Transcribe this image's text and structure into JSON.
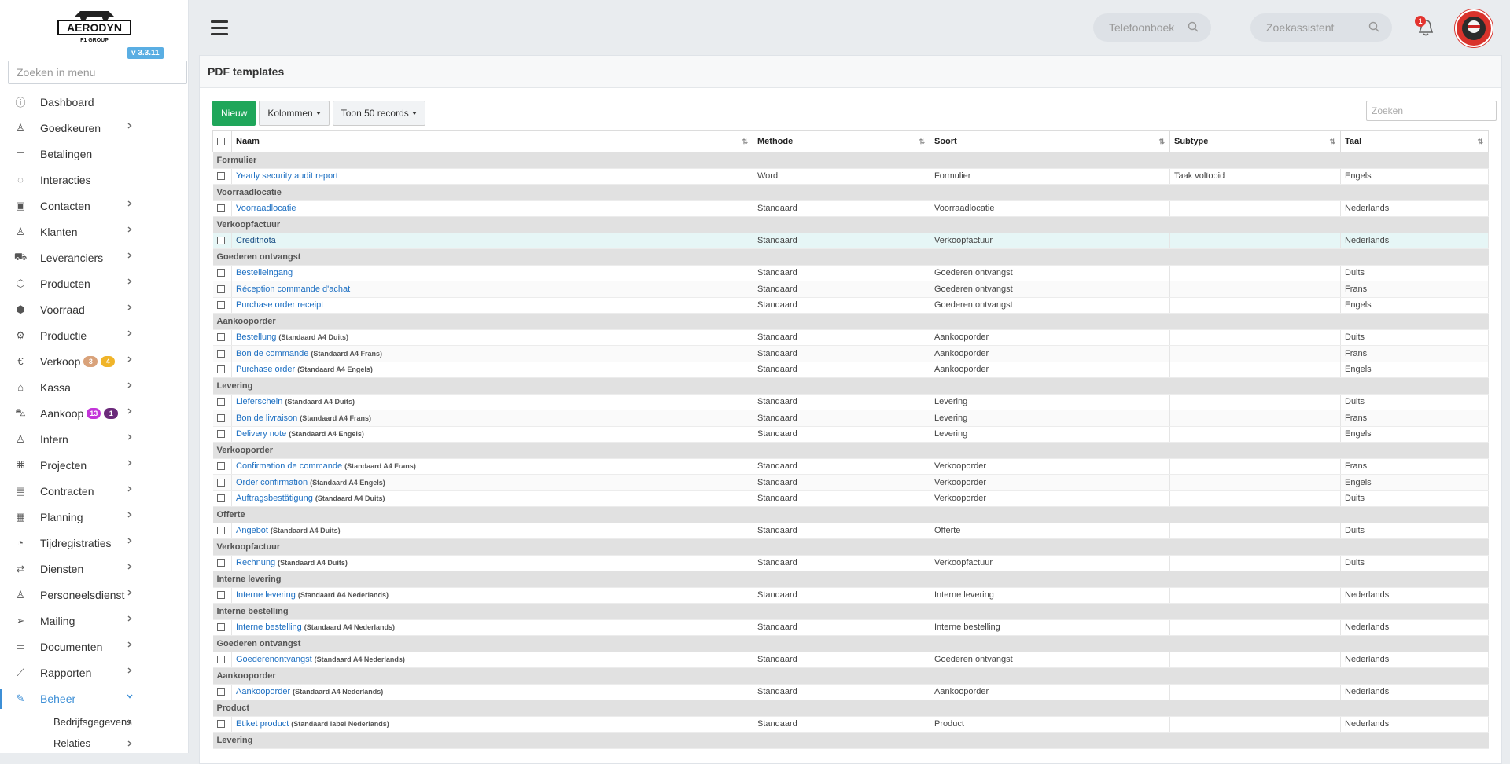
{
  "sidebar": {
    "logo_text": "AERODYN",
    "logo_sub": "F1 GROUP",
    "version": "v 3.3.11",
    "search_placeholder": "Zoeken in menu",
    "items": [
      {
        "label": "Dashboard",
        "icon": "info-icon",
        "chevron": false
      },
      {
        "label": "Goedkeuren",
        "icon": "user-check-icon",
        "chevron": true
      },
      {
        "label": "Betalingen",
        "icon": "credit-card-icon",
        "chevron": false
      },
      {
        "label": "Interacties",
        "icon": "chat-icon",
        "chevron": false
      },
      {
        "label": "Contacten",
        "icon": "contact-card-icon",
        "chevron": true
      },
      {
        "label": "Klanten",
        "icon": "customer-icon",
        "chevron": true
      },
      {
        "label": "Leveranciers",
        "icon": "truck-icon",
        "chevron": true
      },
      {
        "label": "Producten",
        "icon": "box-icon",
        "chevron": true
      },
      {
        "label": "Voorraad",
        "icon": "boxes-icon",
        "chevron": true
      },
      {
        "label": "Productie",
        "icon": "gears-icon",
        "chevron": true
      },
      {
        "label": "Verkoop",
        "icon": "euro-icon",
        "chevron": true,
        "badges": [
          {
            "text": "3",
            "color": "#d9a27a"
          },
          {
            "text": "4",
            "color": "#f0b429"
          }
        ]
      },
      {
        "label": "Kassa",
        "icon": "basket-icon",
        "chevron": true
      },
      {
        "label": "Aankoop",
        "icon": "cart-icon",
        "chevron": true,
        "badges": [
          {
            "text": "13",
            "color": "#c334d9"
          },
          {
            "text": "1",
            "color": "#6b2a7a"
          }
        ]
      },
      {
        "label": "Intern",
        "icon": "users-icon",
        "chevron": true
      },
      {
        "label": "Projecten",
        "icon": "project-icon",
        "chevron": true
      },
      {
        "label": "Contracten",
        "icon": "contract-icon",
        "chevron": true
      },
      {
        "label": "Planning",
        "icon": "calendar-icon",
        "chevron": true
      },
      {
        "label": "Tijdregistraties",
        "icon": "timer-icon",
        "chevron": true
      },
      {
        "label": "Diensten",
        "icon": "refresh-icon",
        "chevron": true
      },
      {
        "label": "Personeelsdienst",
        "icon": "person-icon",
        "chevron": true
      },
      {
        "label": "Mailing",
        "icon": "send-icon",
        "chevron": true
      },
      {
        "label": "Documenten",
        "icon": "folder-icon",
        "chevron": true
      },
      {
        "label": "Rapporten",
        "icon": "chart-line-icon",
        "chevron": true
      },
      {
        "label": "Beheer",
        "icon": "wrench-icon",
        "chevron": true,
        "active": true
      }
    ],
    "sub_items": [
      {
        "label": "Bedrijfsgegevens"
      },
      {
        "label": "Relaties"
      }
    ]
  },
  "topbar": {
    "phonebook_placeholder": "Telefoonboek",
    "assistant_placeholder": "Zoekassistent",
    "notif_count": "1"
  },
  "page": {
    "title": "PDF templates",
    "new_button": "Nieuw",
    "columns_button": "Kolommen",
    "show_button": "Toon 50 records",
    "search_placeholder": "Zoeken"
  },
  "table": {
    "headers": [
      "Naam",
      "Methode",
      "Soort",
      "Subtype",
      "Taal"
    ],
    "rows": [
      {
        "group": "Formulier"
      },
      {
        "name": "Yearly security audit report",
        "tmpl": "",
        "methode": "Word",
        "soort": "Formulier",
        "subtype": "Taak voltooid",
        "taal": "Engels"
      },
      {
        "group": "Voorraadlocatie"
      },
      {
        "name": "Voorraadlocatie",
        "tmpl": "",
        "methode": "Standaard",
        "soort": "Voorraadlocatie",
        "subtype": "",
        "taal": "Nederlands"
      },
      {
        "group": "Verkoopfactuur"
      },
      {
        "name": "Creditnota",
        "tmpl": "",
        "methode": "Standaard",
        "soort": "Verkoopfactuur",
        "subtype": "",
        "taal": "Nederlands",
        "highlight": true
      },
      {
        "group": "Goederen ontvangst"
      },
      {
        "name": "Bestelleingang",
        "tmpl": "",
        "methode": "Standaard",
        "soort": "Goederen ontvangst",
        "subtype": "",
        "taal": "Duits"
      },
      {
        "name": "Réception commande d'achat",
        "tmpl": "",
        "methode": "Standaard",
        "soort": "Goederen ontvangst",
        "subtype": "",
        "taal": "Frans"
      },
      {
        "name": "Purchase order receipt",
        "tmpl": "",
        "methode": "Standaard",
        "soort": "Goederen ontvangst",
        "subtype": "",
        "taal": "Engels"
      },
      {
        "group": "Aankooporder"
      },
      {
        "name": "Bestellung",
        "tmpl": "(Standaard A4 Duits)",
        "methode": "Standaard",
        "soort": "Aankooporder",
        "subtype": "",
        "taal": "Duits"
      },
      {
        "name": "Bon de commande",
        "tmpl": "(Standaard A4 Frans)",
        "methode": "Standaard",
        "soort": "Aankooporder",
        "subtype": "",
        "taal": "Frans"
      },
      {
        "name": "Purchase order",
        "tmpl": "(Standaard A4 Engels)",
        "methode": "Standaard",
        "soort": "Aankooporder",
        "subtype": "",
        "taal": "Engels"
      },
      {
        "group": "Levering"
      },
      {
        "name": "Lieferschein",
        "tmpl": "(Standaard A4 Duits)",
        "methode": "Standaard",
        "soort": "Levering",
        "subtype": "",
        "taal": "Duits"
      },
      {
        "name": "Bon de livraison",
        "tmpl": "(Standaard A4 Frans)",
        "methode": "Standaard",
        "soort": "Levering",
        "subtype": "",
        "taal": "Frans"
      },
      {
        "name": "Delivery note",
        "tmpl": "(Standaard A4 Engels)",
        "methode": "Standaard",
        "soort": "Levering",
        "subtype": "",
        "taal": "Engels"
      },
      {
        "group": "Verkooporder"
      },
      {
        "name": "Confirmation de commande",
        "tmpl": "(Standaard A4 Frans)",
        "methode": "Standaard",
        "soort": "Verkooporder",
        "subtype": "",
        "taal": "Frans"
      },
      {
        "name": "Order confirmation",
        "tmpl": "(Standaard A4 Engels)",
        "methode": "Standaard",
        "soort": "Verkooporder",
        "subtype": "",
        "taal": "Engels"
      },
      {
        "name": "Auftragsbestätigung",
        "tmpl": "(Standaard A4 Duits)",
        "methode": "Standaard",
        "soort": "Verkooporder",
        "subtype": "",
        "taal": "Duits"
      },
      {
        "group": "Offerte"
      },
      {
        "name": "Angebot",
        "tmpl": "(Standaard A4 Duits)",
        "methode": "Standaard",
        "soort": "Offerte",
        "subtype": "",
        "taal": "Duits"
      },
      {
        "group": "Verkoopfactuur"
      },
      {
        "name": "Rechnung",
        "tmpl": "(Standaard A4 Duits)",
        "methode": "Standaard",
        "soort": "Verkoopfactuur",
        "subtype": "",
        "taal": "Duits"
      },
      {
        "group": "Interne levering"
      },
      {
        "name": "Interne levering",
        "tmpl": "(Standaard A4 Nederlands)",
        "methode": "Standaard",
        "soort": "Interne levering",
        "subtype": "",
        "taal": "Nederlands"
      },
      {
        "group": "Interne bestelling"
      },
      {
        "name": "Interne bestelling",
        "tmpl": "(Standaard A4 Nederlands)",
        "methode": "Standaard",
        "soort": "Interne bestelling",
        "subtype": "",
        "taal": "Nederlands"
      },
      {
        "group": "Goederen ontvangst"
      },
      {
        "name": "Goederenontvangst",
        "tmpl": "(Standaard A4 Nederlands)",
        "methode": "Standaard",
        "soort": "Goederen ontvangst",
        "subtype": "",
        "taal": "Nederlands"
      },
      {
        "group": "Aankooporder"
      },
      {
        "name": "Aankooporder",
        "tmpl": "(Standaard A4 Nederlands)",
        "methode": "Standaard",
        "soort": "Aankooporder",
        "subtype": "",
        "taal": "Nederlands"
      },
      {
        "group": "Product"
      },
      {
        "name": "Etiket product",
        "tmpl": "(Standaard label Nederlands)",
        "methode": "Standaard",
        "soort": "Product",
        "subtype": "",
        "taal": "Nederlands"
      },
      {
        "group": "Levering"
      }
    ]
  },
  "colors": {
    "accent": "#3d8fd6",
    "primary_button": "#1fa65a",
    "link": "#1c6fc2"
  }
}
